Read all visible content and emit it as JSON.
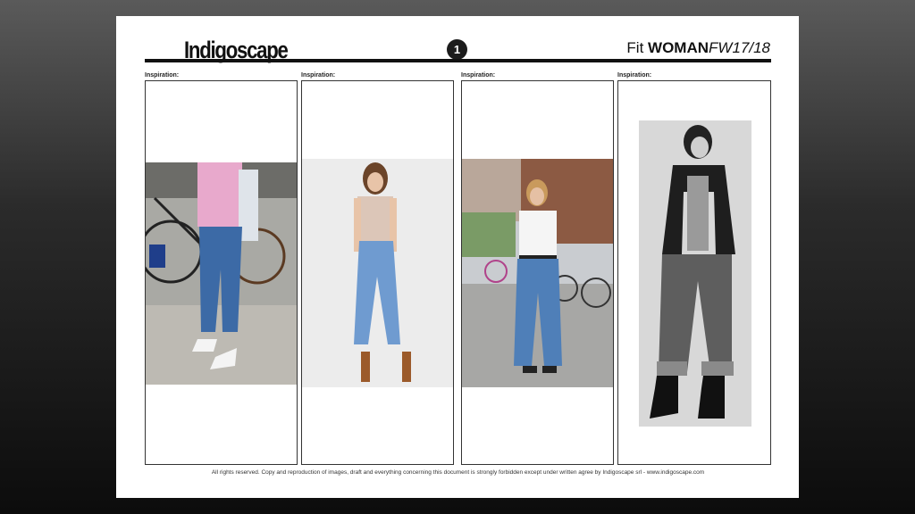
{
  "brand": {
    "logo_text": "Indigoscape"
  },
  "page_number": "1",
  "header": {
    "fit_label": "Fit",
    "category": "WOMAN",
    "season": "FW17/18"
  },
  "panels": [
    {
      "label": "Inspiration:",
      "photo_icon": "street-style-photo-icon"
    },
    {
      "label": "Inspiration:",
      "photo_icon": "studio-model-photo-icon"
    },
    {
      "label": "Inspiration:",
      "photo_icon": "street-style-photo-icon"
    },
    {
      "label": "Inspiration:",
      "photo_icon": "bw-model-photo-icon"
    }
  ],
  "footer": "All rights reserved. Copy and reproduction of images, draft and everything concerning this document is strongly forbidden except under written agree by Indigoscape srl - www.indigoscape.com",
  "colors": {
    "background_top": "#5a5a5a",
    "background_bottom": "#0c0c0c",
    "page": "#ffffff",
    "denim": "#4a78b0"
  }
}
